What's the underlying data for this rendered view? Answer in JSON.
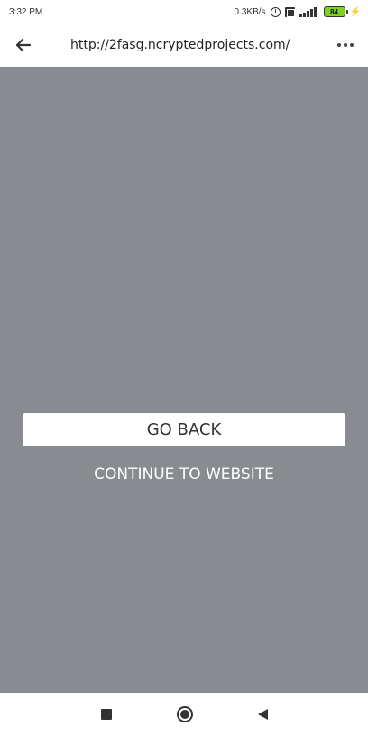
{
  "status_bar": {
    "time": "3:32 PM",
    "network_speed": "0.3KB/s",
    "battery_level": "84",
    "icons": [
      "alarm-icon",
      "nfc-icon",
      "signal-icon",
      "battery-icon",
      "charging-icon"
    ]
  },
  "browser": {
    "url": "http://2fasg.ncryptedprojects.com/",
    "icons": [
      "back-arrow-icon",
      "more-options-icon"
    ]
  },
  "page": {
    "go_back_label": "GO BACK",
    "continue_label": "CONTINUE TO WEBSITE",
    "background_color": "#888b90"
  },
  "nav_bar": {
    "icons": [
      "recents-icon",
      "home-icon",
      "back-icon"
    ]
  }
}
